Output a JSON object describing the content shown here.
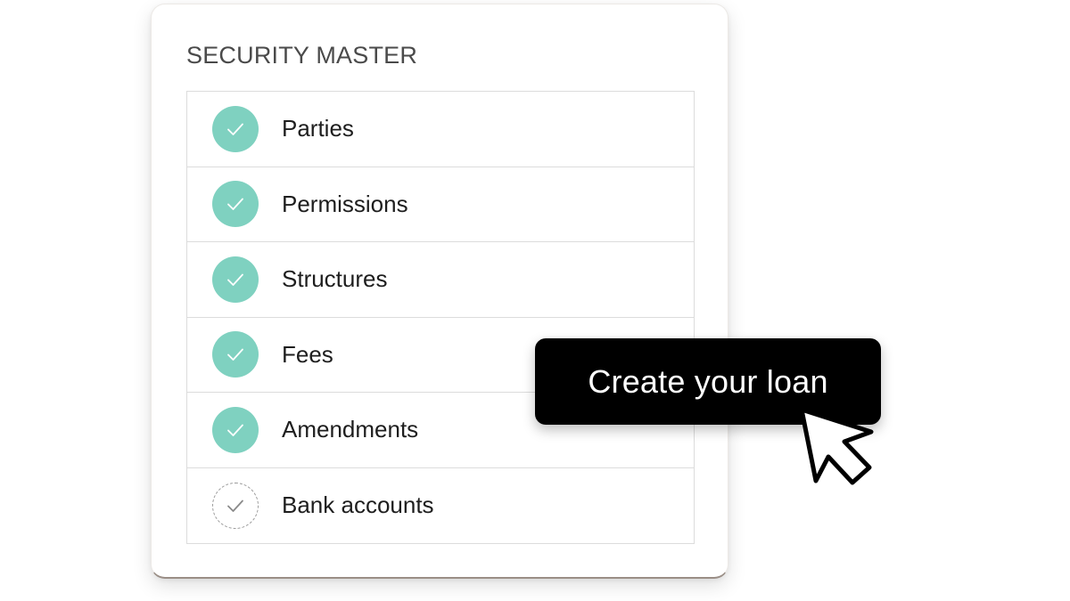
{
  "card": {
    "title": "SECURITY MASTER",
    "items": [
      {
        "label": "Parties",
        "status": "complete"
      },
      {
        "label": "Permissions",
        "status": "complete"
      },
      {
        "label": "Structures",
        "status": "complete"
      },
      {
        "label": "Fees",
        "status": "complete"
      },
      {
        "label": "Amendments",
        "status": "complete"
      },
      {
        "label": "Bank accounts",
        "status": "pending"
      }
    ]
  },
  "cta": {
    "label": "Create your loan"
  },
  "colors": {
    "complete": "#7fd1c0",
    "check": "#ffffff",
    "pending_check": "#8a8a8a",
    "cta_bg": "#000000",
    "cta_text": "#ffffff"
  },
  "icons": {
    "complete": "check-circle-icon",
    "pending": "dashed-check-circle-icon",
    "cursor": "mouse-pointer-icon"
  }
}
